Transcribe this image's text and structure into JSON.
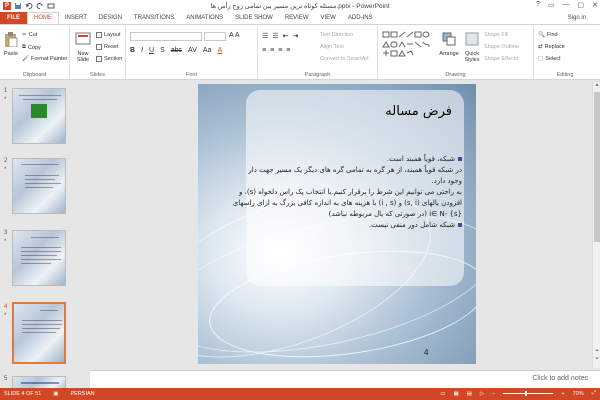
{
  "window": {
    "title": "مسئله کوتاه ترین مسیر بین تمامی زوج رأس ها.pptx - PowerPoint",
    "controls": [
      "?",
      "▭",
      "—",
      "▢",
      "✕"
    ]
  },
  "tabs": [
    "FILE",
    "HOME",
    "INSERT",
    "DESIGN",
    "TRANSITIONS",
    "ANIMATIONS",
    "SLIDE SHOW",
    "REVIEW",
    "VIEW",
    "ADD-INS"
  ],
  "signin": "Sign in",
  "ribbon": {
    "clipboard": {
      "label": "Clipboard",
      "paste": "Paste",
      "cut": "Cut",
      "copy": "Copy",
      "format_painter": "Format Painter"
    },
    "slides": {
      "label": "Slides",
      "new_slide": "New Slide",
      "layout": "Layout",
      "reset": "Reset",
      "section": "Section"
    },
    "font": {
      "label": "Font"
    },
    "paragraph": {
      "label": "Paragraph",
      "text_direction": "Text Direction",
      "align_text": "Align Text",
      "convert_smartart": "Convert to SmartArt"
    },
    "drawing": {
      "label": "Drawing",
      "arrange": "Arrange",
      "quick_styles": "Quick Styles",
      "shape_fill": "Shape Fill",
      "shape_outline": "Shape Outline",
      "shape_effects": "Shape Effects"
    },
    "editing": {
      "label": "Editing",
      "find": "Find",
      "replace": "Replace",
      "select": "Select"
    }
  },
  "thumbnails": [
    {
      "num": "1",
      "star": "*"
    },
    {
      "num": "2",
      "star": "*"
    },
    {
      "num": "3",
      "star": "*"
    },
    {
      "num": "4",
      "star": "*"
    },
    {
      "num": "5",
      "star": ""
    }
  ],
  "slide": {
    "title": "فرض مساله",
    "lines": [
      "شبکه، قویاً همبند است.",
      "در شبکه قویاً همبند، از هر گره به تمامی گره های دیگر یک مسیر جهت دار وجود دارد.",
      "به راحتی می توانیم این شرط را برقرار کنیم.با انتخاب یک راس دلخواه (s)، و افزودن یالهای (s, i) و (i , s) با هزینه های به اندازه کافی بزرگ به ازای راسهای",
      "i∈ N- {s} (در صورتی که یال مربوطه نباشد)",
      "شبکه شامل دور منفی نیست."
    ],
    "number": "4"
  },
  "notes_placeholder": "Click to add notes",
  "status": {
    "slide_of": "SLIDE 4 OF 51",
    "language": "PERSIAN",
    "zoom": "70%",
    "zoom_fraction": 0.45
  },
  "colors": {
    "accent": "#d24726",
    "bullet": "#2f5597",
    "selected_thumb": "#e07a3f"
  }
}
